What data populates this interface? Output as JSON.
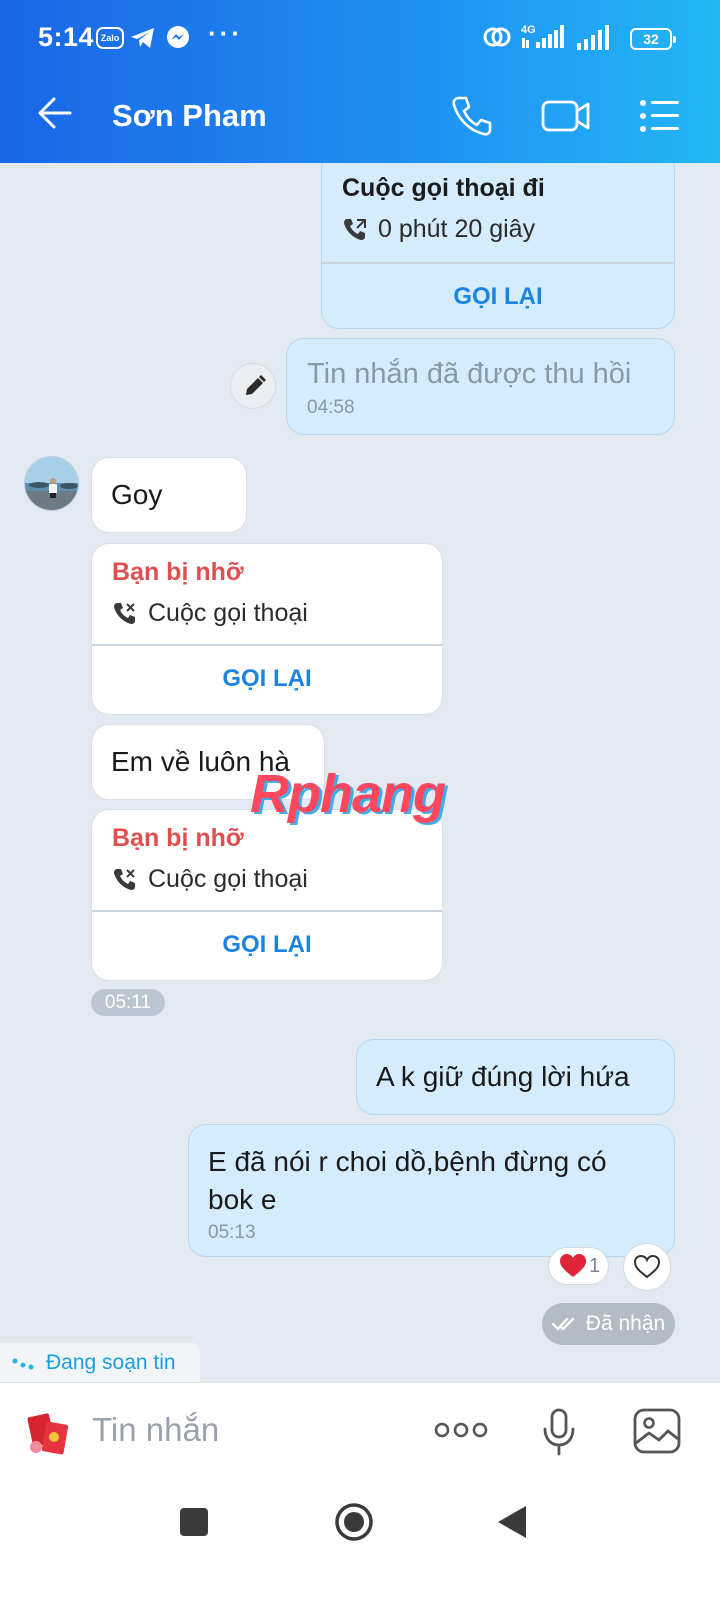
{
  "status_bar": {
    "time": "5:14",
    "battery": "32",
    "icons": [
      "zalo-icon",
      "telegram-icon",
      "messenger-icon",
      "more-dots-icon",
      "hotspot-icon",
      "signal-4g-icon",
      "signal-icon",
      "battery-icon"
    ]
  },
  "header": {
    "title": "Sơn Pham",
    "icons": [
      "back-arrow-icon",
      "phone-icon",
      "video-call-icon",
      "menu-list-icon"
    ]
  },
  "messages": {
    "outgoing_call": {
      "title": "Cuộc gọi thoại đi",
      "detail": "0 phút 20 giây",
      "action": "GỌI LẠI"
    },
    "recalled": {
      "text": "Tin nhắn đã được thu hồi",
      "time": "04:58"
    },
    "goy": {
      "text": "Goy"
    },
    "missed_call_1": {
      "title": "Bạn bị nhỡ",
      "detail": "Cuộc gọi thoại",
      "action": "GỌI LẠI"
    },
    "em_ve": {
      "text": "Em về luôn hà"
    },
    "missed_call_2": {
      "title": "Bạn bị nhỡ",
      "detail": "Cuộc gọi thoại",
      "action": "GỌI LẠI"
    },
    "time_chip": "05:11",
    "ak_giu": {
      "text": "A k giữ đúng lời hứa"
    },
    "e_da_noi": {
      "text": "E đã nói r choi dồ,bệnh đừng có bok e",
      "time": "05:13"
    },
    "reaction": {
      "count": "1"
    },
    "delivery_status": "Đã nhận",
    "typing": "Đang soạn tin"
  },
  "watermark": "Rphang",
  "composer": {
    "placeholder": "Tin nhắn"
  },
  "colors": {
    "header_start": "#1a66e6",
    "header_end": "#22b6f5",
    "sent_bubble": "#d4ecfd",
    "received_bubble": "#ffffff",
    "missed": "#df4f4f",
    "action": "#1b84e0",
    "chat_bg": "#e2e9f1"
  }
}
